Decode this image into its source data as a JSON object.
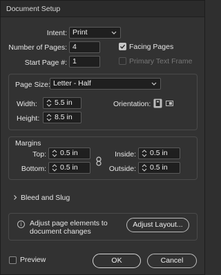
{
  "dialog": {
    "title": "Document Setup"
  },
  "intent": {
    "label": "Intent:",
    "value": "Print"
  },
  "pages": {
    "number_label": "Number of Pages:",
    "number_value": "4",
    "start_label": "Start Page #:",
    "start_value": "1",
    "facing_label": "Facing Pages",
    "facing_checked": true,
    "primary_label": "Primary Text Frame",
    "primary_checked": false
  },
  "page_size": {
    "label": "Page Size:",
    "value": "Letter - Half",
    "width_label": "Width:",
    "width_value": "5.5 in",
    "height_label": "Height:",
    "height_value": "8.5 in",
    "orientation_label": "Orientation:"
  },
  "margins": {
    "title": "Margins",
    "top_label": "Top:",
    "top_value": "0.5 in",
    "bottom_label": "Bottom:",
    "bottom_value": "0.5 in",
    "inside_label": "Inside:",
    "inside_value": "0.5 in",
    "outside_label": "Outside:",
    "outside_value": "0.5 in"
  },
  "bleed": {
    "label": "Bleed and Slug"
  },
  "info": {
    "text_line1": "Adjust page elements to",
    "text_line2": "document changes",
    "button": "Adjust Layout..."
  },
  "footer": {
    "preview_label": "Preview",
    "ok": "OK",
    "cancel": "Cancel"
  },
  "colors": {
    "background": "#323232",
    "field": "#1f1f1f",
    "border": "#5a5a5a",
    "text": "#e6e6e6"
  }
}
